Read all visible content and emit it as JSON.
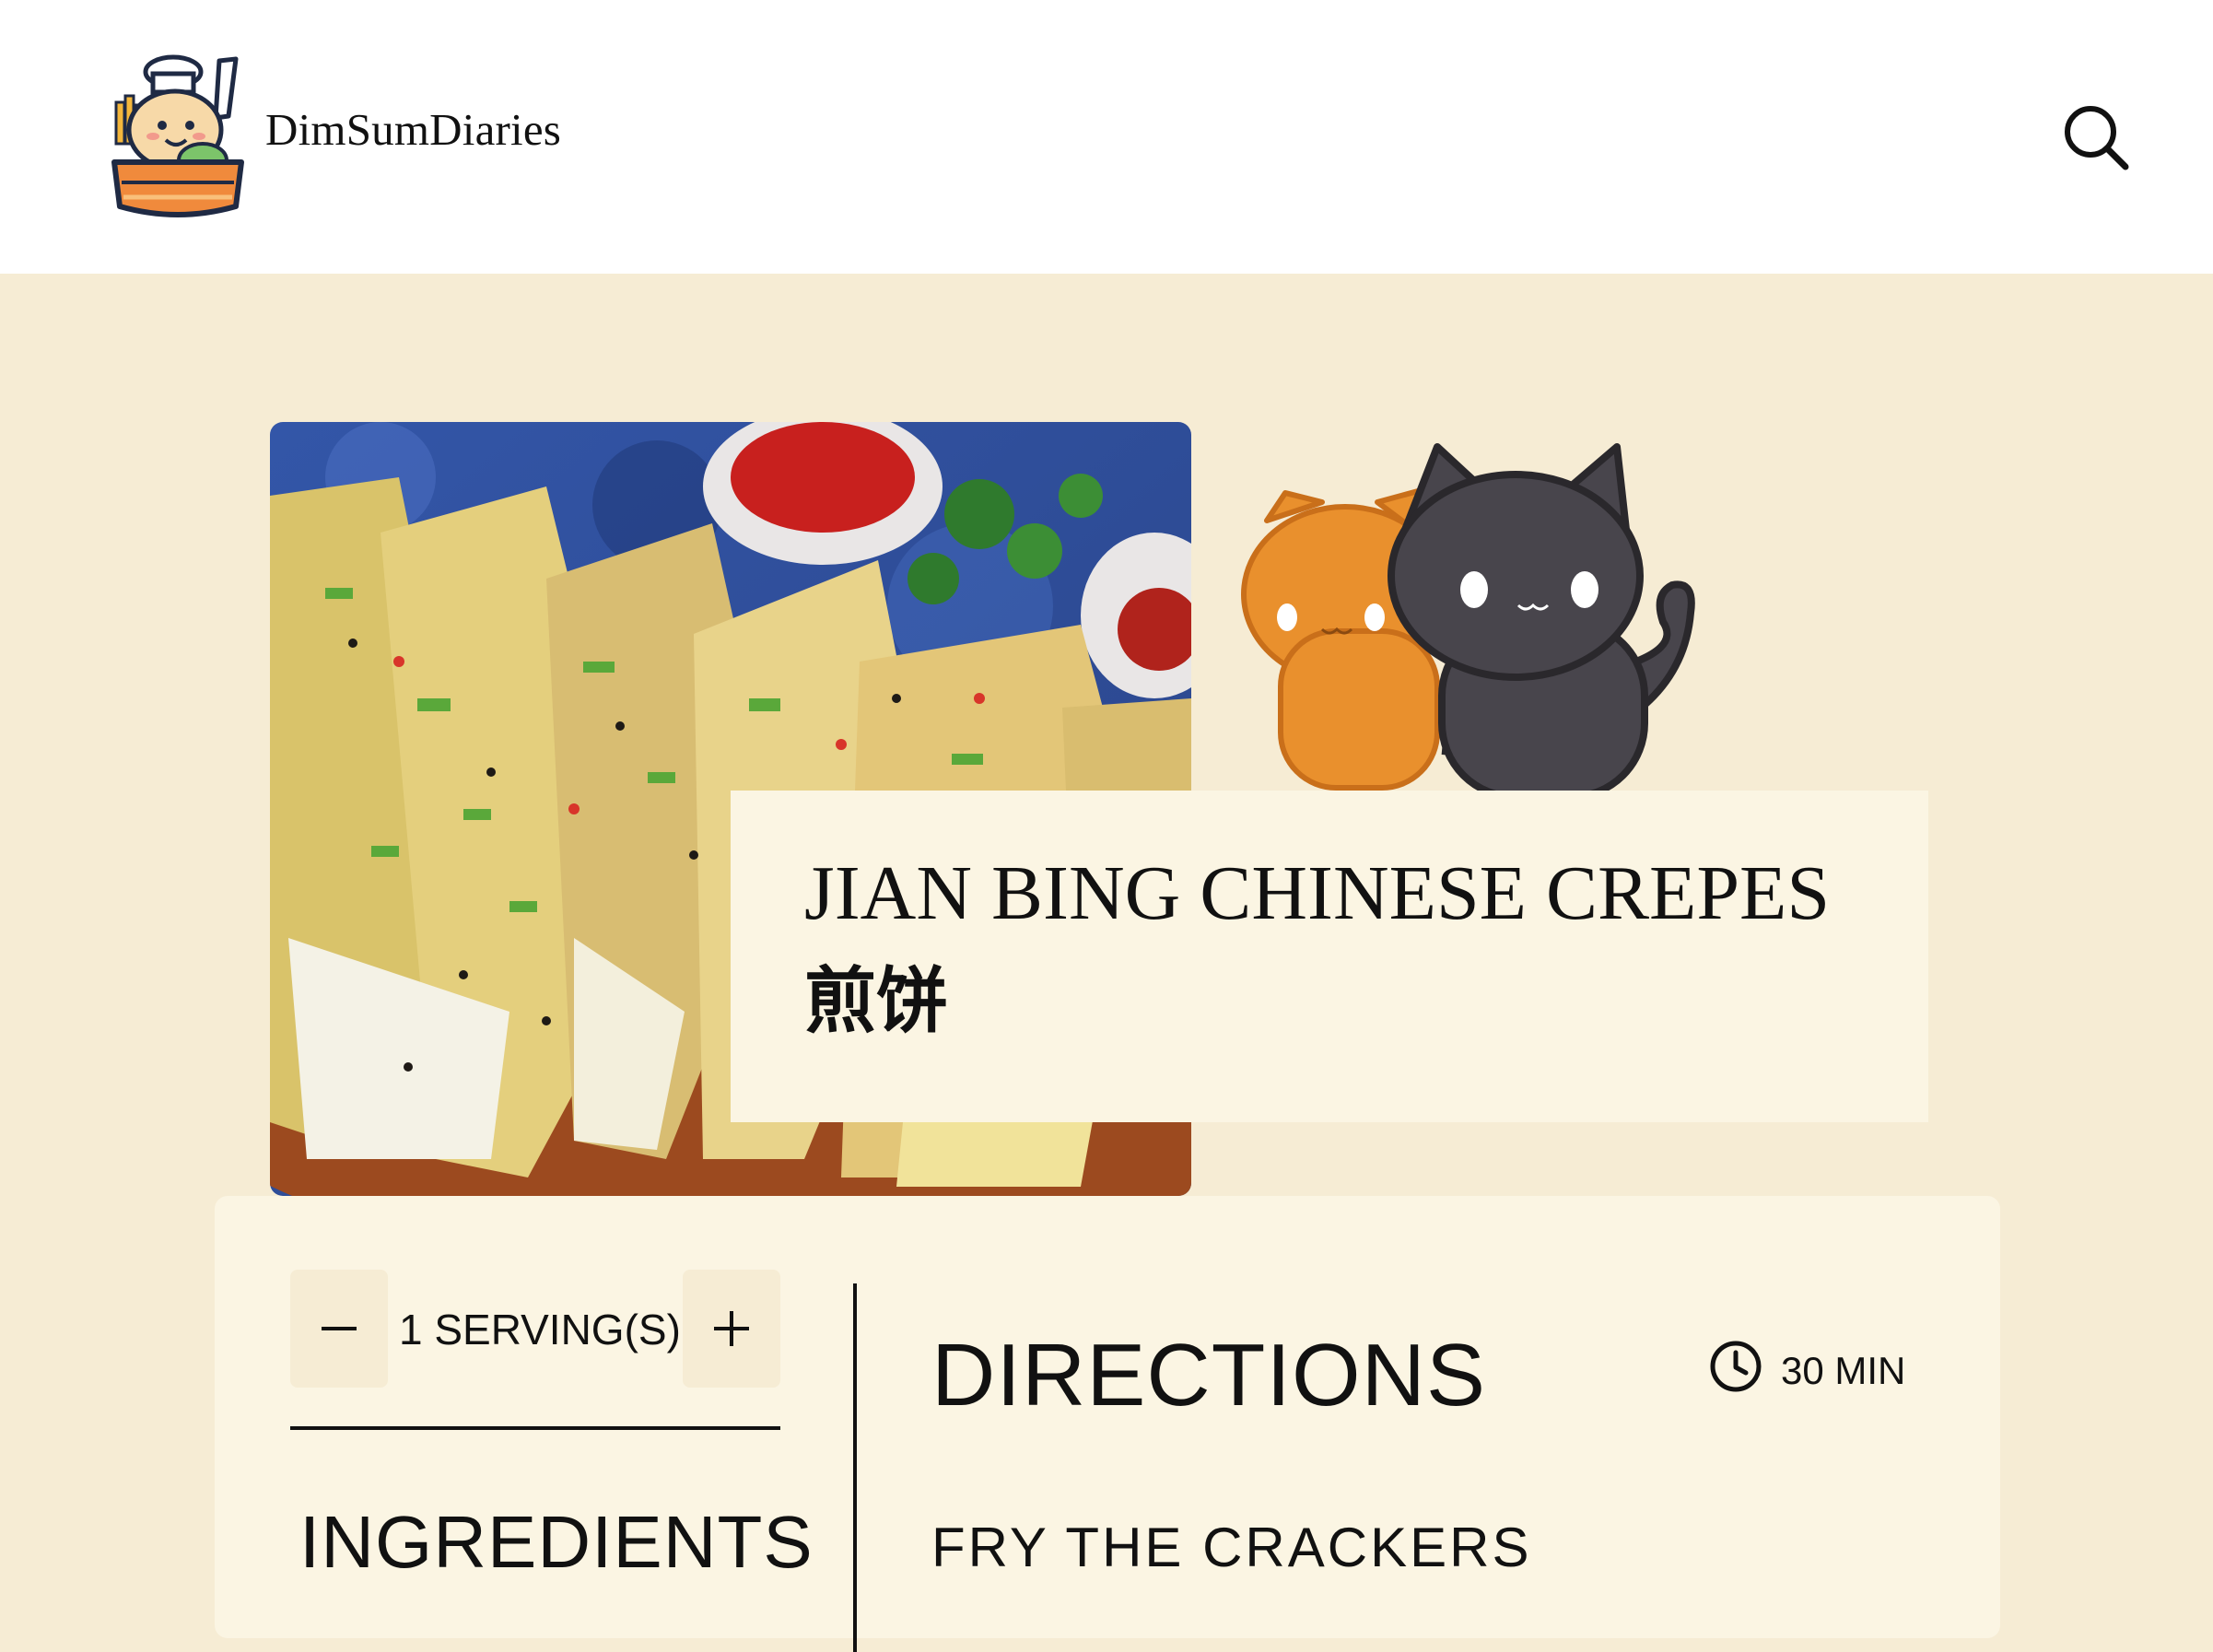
{
  "header": {
    "site_name": "DimSumDiaries",
    "logo_icon": "chef-dumpling-logo-icon",
    "search_icon": "search-icon"
  },
  "hero": {
    "photo": "jian-bing-crepes-photo",
    "decoration": "two-cats-illustration"
  },
  "recipe": {
    "title": "JIAN BING CHINESE CREPES",
    "title_cn": "煎饼"
  },
  "servings": {
    "label": "1 SERVING(S)",
    "decrease_icon": "minus-icon",
    "increase_icon": "plus-icon"
  },
  "ingredients": {
    "heading": "INGREDIENTS"
  },
  "directions": {
    "heading": "DIRECTIONS",
    "time": "30 MIN",
    "time_icon": "clock-icon",
    "first_step": "FRY THE CRACKERS"
  },
  "colors": {
    "page_bg": "#f6ecd4",
    "card_bg": "#fbf5e3",
    "header_bg": "#ffffff",
    "text": "#111111"
  }
}
